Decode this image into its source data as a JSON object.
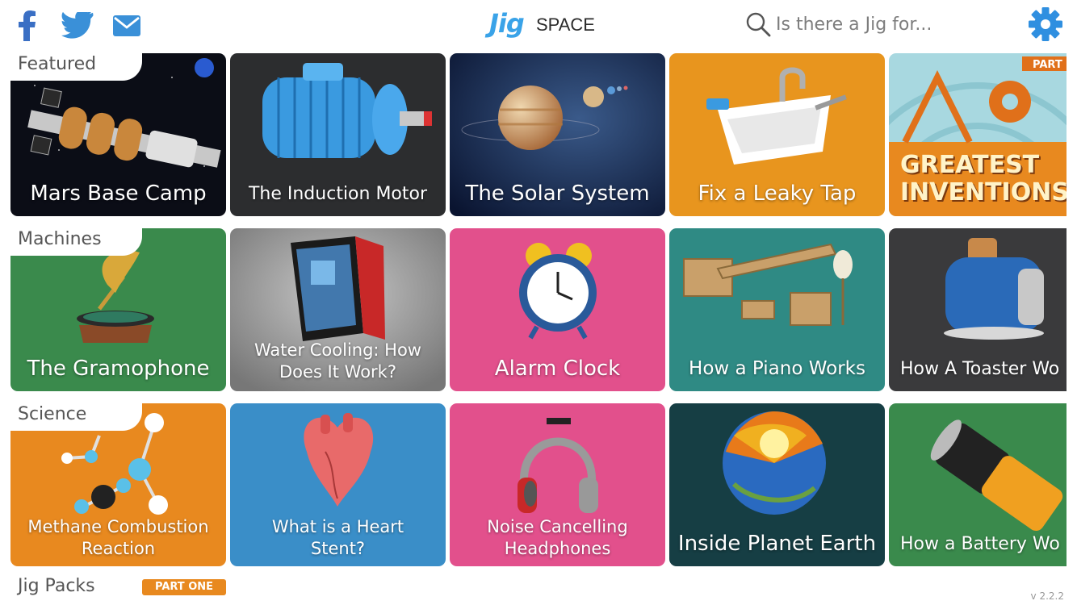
{
  "header": {
    "logo_jig": "Jig",
    "logo_space": "SPACE",
    "search_placeholder": "Is there a Jig for...",
    "icons": [
      "facebook-icon",
      "twitter-icon",
      "mail-icon",
      "search-icon",
      "gear-icon"
    ]
  },
  "rows": [
    {
      "label": "Featured",
      "cards": [
        {
          "title": "Mars Base Camp",
          "color": "#0b0d16"
        },
        {
          "title": "The Induction Motor",
          "color": "#2c2d2f"
        },
        {
          "title": "The Solar System",
          "color": "#14234a"
        },
        {
          "title": "Fix a Leaky Tap",
          "color": "#e8951e"
        },
        {
          "title": "GREATEST INVENTIONS",
          "color": "#e8891f"
        }
      ]
    },
    {
      "label": "Machines",
      "cards": [
        {
          "title": "The Gramophone",
          "color": "#3a8a4c"
        },
        {
          "title": "Water Cooling: How Does It Work?",
          "color": "#8a8a8a"
        },
        {
          "title": "Alarm Clock",
          "color": "#e2508c"
        },
        {
          "title": "How a Piano Works",
          "color": "#2f8a84"
        },
        {
          "title": "How A Toaster Wo",
          "color": "#3a3a3c"
        }
      ]
    },
    {
      "label": "Science",
      "cards": [
        {
          "title": "Methane Combustion Reaction",
          "color": "#e8891f"
        },
        {
          "title": "What is a Heart Stent?",
          "color": "#3a8ec8"
        },
        {
          "title": "Noise Cancelling Headphones",
          "color": "#e2508c"
        },
        {
          "title": "Inside Planet Earth",
          "color": "#163e44"
        },
        {
          "title": "How a Battery Wo",
          "color": "#3a8a4c"
        }
      ]
    }
  ],
  "next_row": {
    "label": "Jig Packs",
    "badge": "PART ONE"
  },
  "version": "v 2.2.2"
}
